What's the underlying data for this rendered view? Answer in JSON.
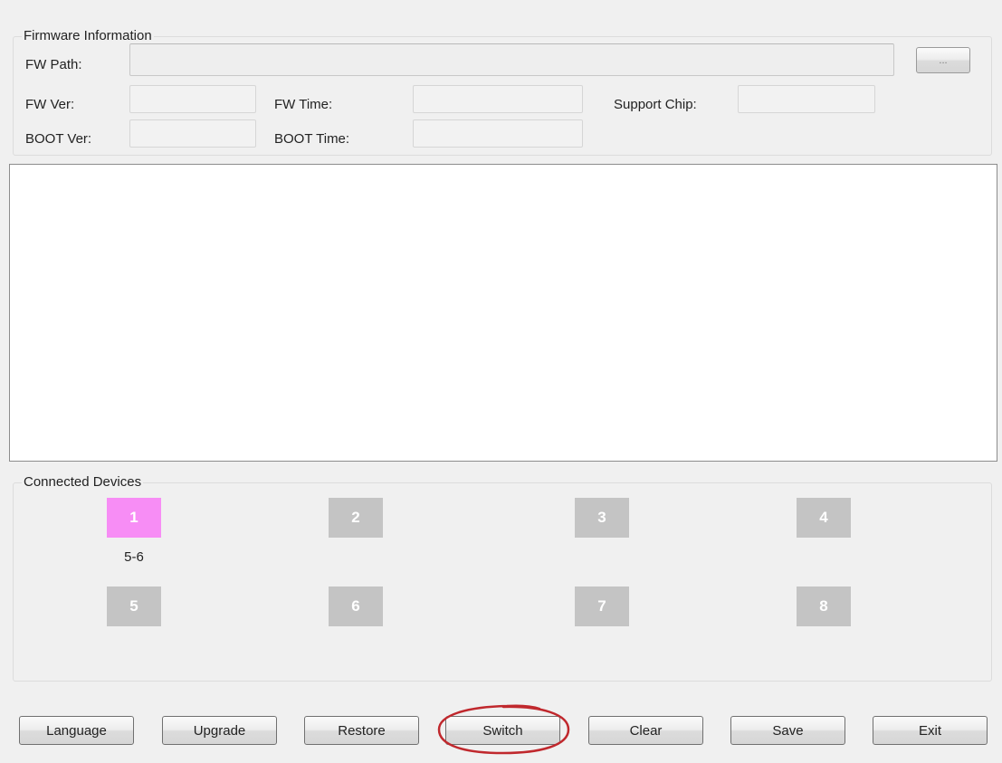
{
  "firmware_info": {
    "group_title": "Firmware Information",
    "fw_path_label": "FW Path:",
    "fw_path_value": "",
    "browse_label": "...",
    "fw_ver_label": "FW Ver:",
    "fw_ver_value": "",
    "fw_time_label": "FW Time:",
    "fw_time_value": "",
    "support_chip_label": "Support Chip:",
    "support_chip_value": "",
    "boot_ver_label": "BOOT Ver:",
    "boot_ver_value": "",
    "boot_time_label": "BOOT Time:",
    "boot_time_value": ""
  },
  "log": {
    "content": ""
  },
  "connected_devices": {
    "group_title": "Connected Devices",
    "slots": [
      {
        "label": "1",
        "sub": "5-6",
        "active": true
      },
      {
        "label": "2",
        "sub": "",
        "active": false
      },
      {
        "label": "3",
        "sub": "",
        "active": false
      },
      {
        "label": "4",
        "sub": "",
        "active": false
      },
      {
        "label": "5",
        "sub": "",
        "active": false
      },
      {
        "label": "6",
        "sub": "",
        "active": false
      },
      {
        "label": "7",
        "sub": "",
        "active": false
      },
      {
        "label": "8",
        "sub": "",
        "active": false
      }
    ],
    "active_color": "#f78df5",
    "inactive_color": "#c4c4c4"
  },
  "buttons": {
    "language": "Language",
    "upgrade": "Upgrade",
    "restore": "Restore",
    "switch": "Switch",
    "clear": "Clear",
    "save": "Save",
    "exit": "Exit"
  },
  "annotation": {
    "highlight_color": "#c0282d"
  }
}
